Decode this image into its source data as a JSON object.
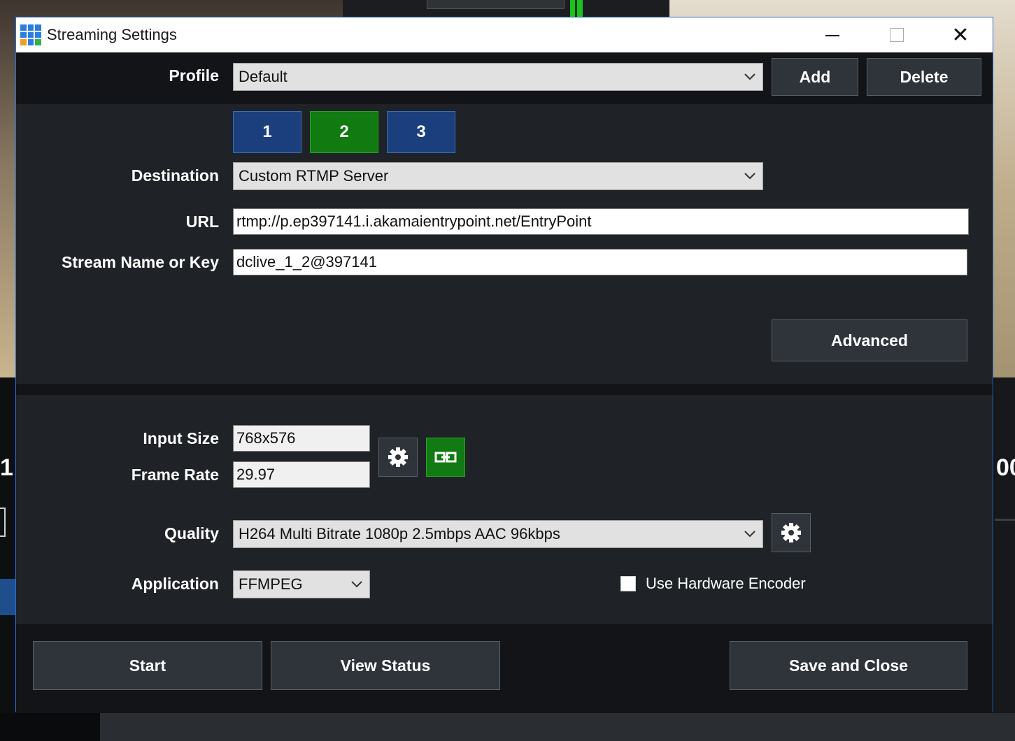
{
  "background": {
    "left_number": "1",
    "right_number": "00"
  },
  "window": {
    "title": "Streaming Settings",
    "icons": {
      "app": "app-grid-icon",
      "minimize": "minimize-icon",
      "maximize": "maximize-icon",
      "close": "close-icon"
    },
    "close_glyph": "✕"
  },
  "profile": {
    "label": "Profile",
    "value": "Default",
    "add_label": "Add",
    "delete_label": "Delete"
  },
  "tabs": [
    {
      "label": "1",
      "active": false
    },
    {
      "label": "2",
      "active": true
    },
    {
      "label": "3",
      "active": false
    }
  ],
  "destination": {
    "label": "Destination",
    "value": "Custom RTMP Server"
  },
  "url": {
    "label": "URL",
    "value": "rtmp://p.ep397141.i.akamaientrypoint.net/EntryPoint"
  },
  "stream_key": {
    "label": "Stream Name or Key",
    "value": "dclive_1_2@397141"
  },
  "advanced_label": "Advanced",
  "input_size": {
    "label": "Input  Size",
    "value": "768x576"
  },
  "frame_rate": {
    "label": "Frame Rate",
    "value": "29.97"
  },
  "quality": {
    "label": "Quality",
    "value": "H264 Multi Bitrate 1080p 2.5mbps AAC 96kbps"
  },
  "application": {
    "label": "Application",
    "value": "FFMPEG"
  },
  "hardware_encoder": {
    "label": "Use Hardware Encoder",
    "checked": false
  },
  "footer": {
    "start_label": "Start",
    "view_status_label": "View Status",
    "save_close_label": "Save and Close"
  },
  "colors": {
    "accent_blue": "#1b3f7c",
    "accent_green": "#117a11",
    "window_border": "#2b6fd1",
    "panel": "#1f2226",
    "panel_dark": "#121417"
  }
}
